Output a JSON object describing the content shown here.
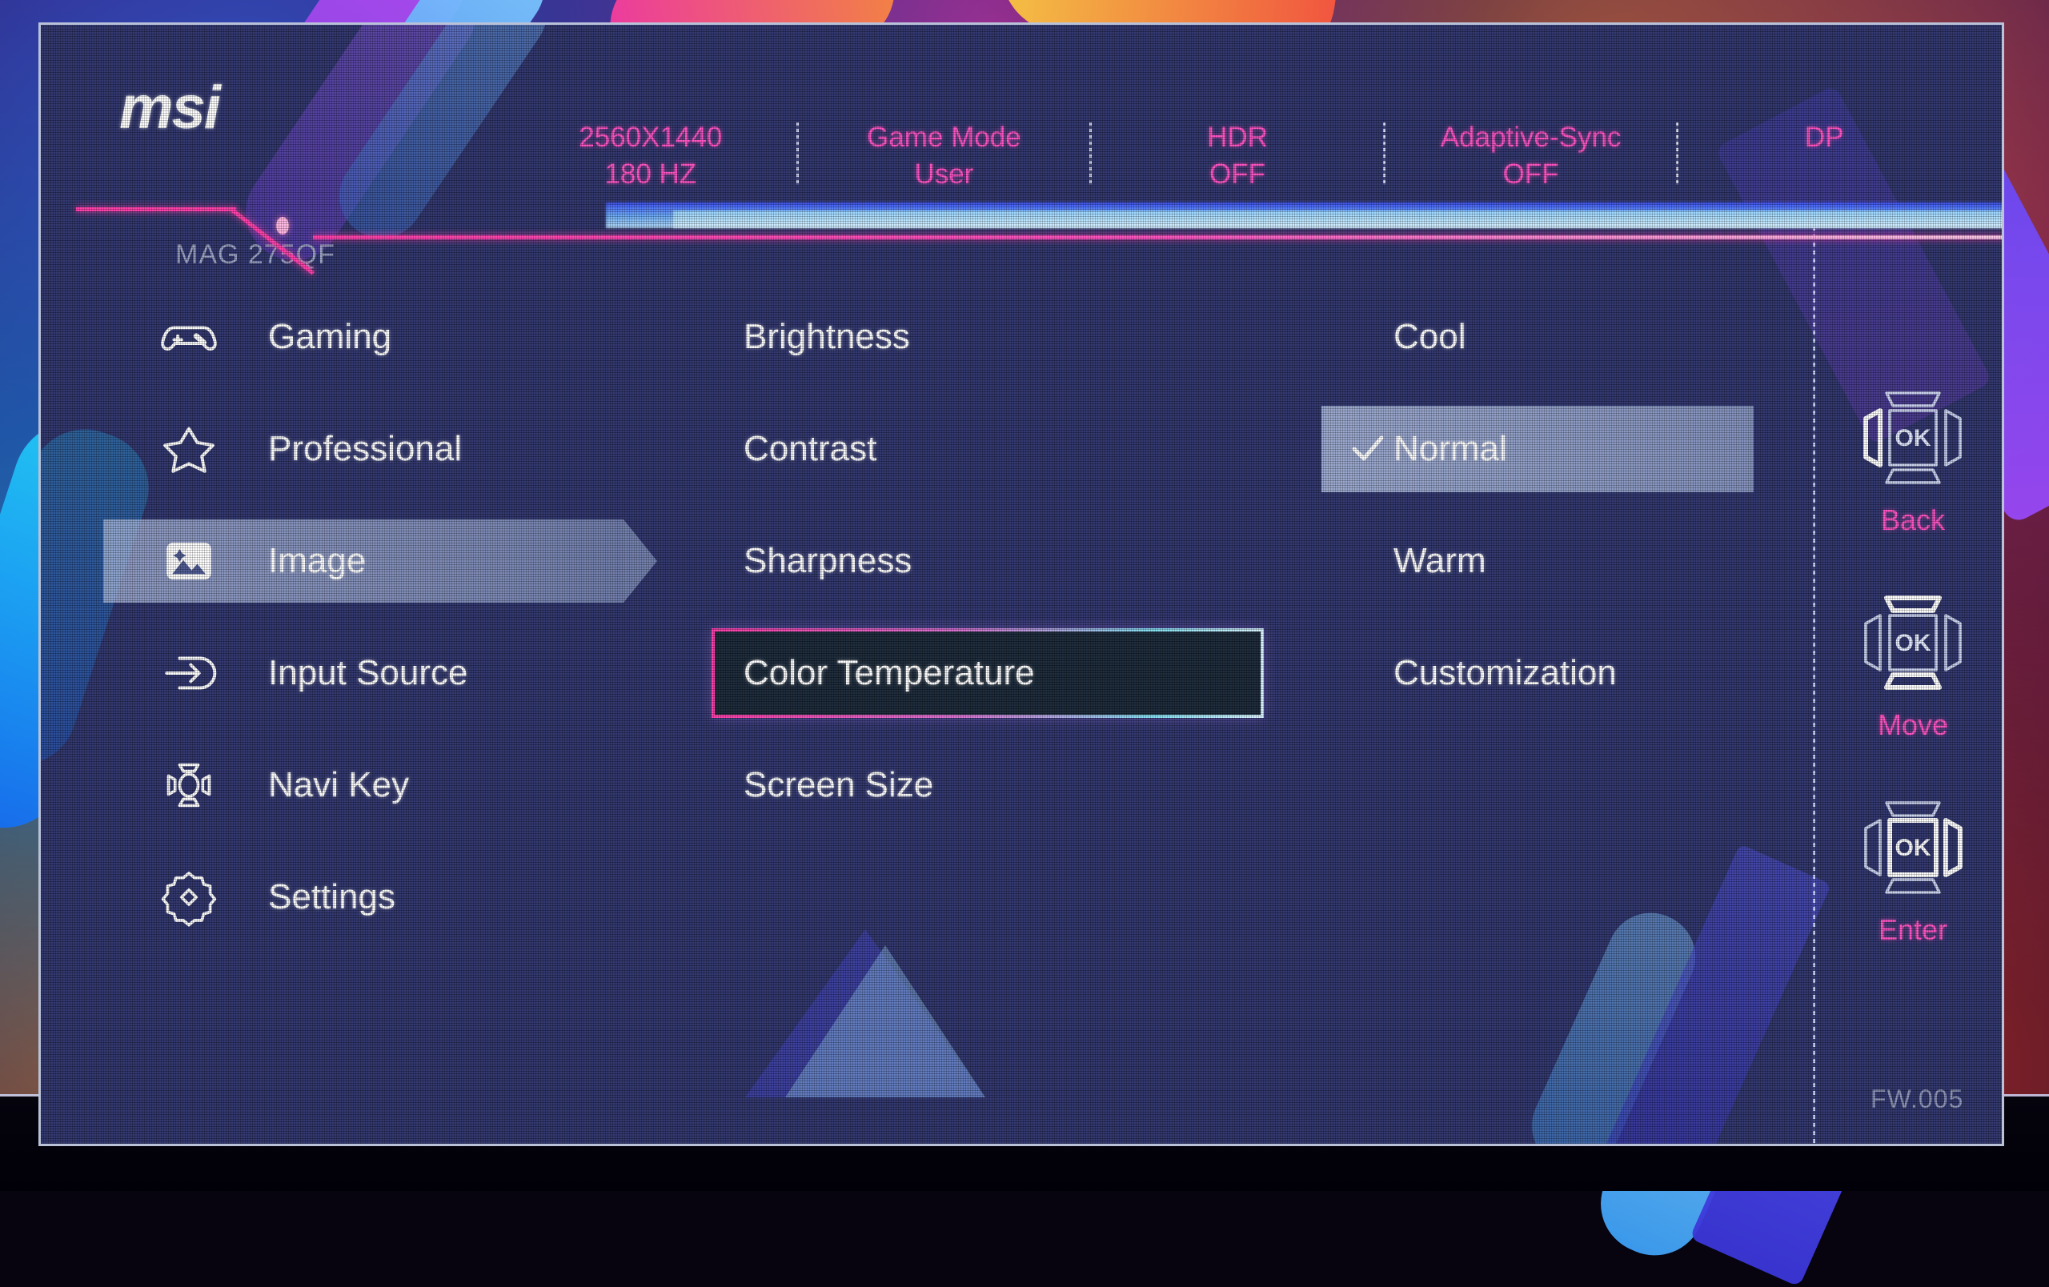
{
  "wallpaper": {
    "description": "abstract geometric neon wallpaper"
  },
  "osd": {
    "brand_logo": "msi",
    "model": "MAG 275QF",
    "firmware": "FW.005",
    "accent_pink": "#ff4fc0",
    "accent_cyan": "#7fe0f2",
    "panel_bg": "#2a3068",
    "highlight_bg": "#afbee1"
  },
  "status_bar": [
    {
      "name": "resolution",
      "title": "2560X1440",
      "value": "180 HZ"
    },
    {
      "name": "game-mode",
      "title": "Game Mode",
      "value": "User"
    },
    {
      "name": "hdr",
      "title": "HDR",
      "value": "OFF"
    },
    {
      "name": "adaptive-sync",
      "title": "Adaptive-Sync",
      "value": "OFF"
    },
    {
      "name": "input",
      "title": "DP",
      "value": ""
    }
  ],
  "sidebar": {
    "items": [
      {
        "label": "Gaming",
        "icon": "gamepad-icon",
        "selected": false
      },
      {
        "label": "Professional",
        "icon": "star-icon",
        "selected": false
      },
      {
        "label": "Image",
        "icon": "picture-icon",
        "selected": true
      },
      {
        "label": "Input Source",
        "icon": "input-arrow-icon",
        "selected": false
      },
      {
        "label": "Navi Key",
        "icon": "navi-key-icon",
        "selected": false
      },
      {
        "label": "Settings",
        "icon": "gear-icon",
        "selected": false
      }
    ]
  },
  "items_column": {
    "items": [
      {
        "label": "Brightness",
        "focused": false
      },
      {
        "label": "Contrast",
        "focused": false
      },
      {
        "label": "Sharpness",
        "focused": false
      },
      {
        "label": "Color Temperature",
        "focused": true
      },
      {
        "label": "Screen Size",
        "focused": false
      }
    ]
  },
  "values_column": {
    "items": [
      {
        "label": "Cool",
        "checked": false,
        "highlighted": false
      },
      {
        "label": "Normal",
        "checked": true,
        "highlighted": true
      },
      {
        "label": "Warm",
        "checked": false,
        "highlighted": false
      },
      {
        "label": "Customization",
        "checked": false,
        "highlighted": false
      }
    ]
  },
  "nav_hints": [
    {
      "label": "Back",
      "icon": "navi-back-icon",
      "key": "OK"
    },
    {
      "label": "Move",
      "icon": "navi-move-icon",
      "key": "OK"
    },
    {
      "label": "Enter",
      "icon": "navi-enter-icon",
      "key": "OK"
    }
  ]
}
